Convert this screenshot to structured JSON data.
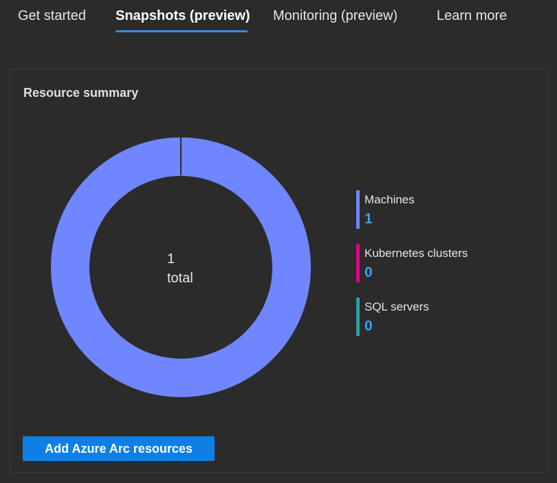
{
  "tabs": [
    {
      "label": "Get started"
    },
    {
      "label": "Snapshots (preview)",
      "active": true
    },
    {
      "label": "Monitoring (preview)"
    },
    {
      "label": "Learn more"
    }
  ],
  "resource_summary": {
    "title": "Resource summary",
    "total_value": "1",
    "total_label": "total",
    "legend": [
      {
        "label": "Machines",
        "value": "1",
        "color": "#6f86ff"
      },
      {
        "label": "Kubernetes clusters",
        "value": "0",
        "color": "#e3008c"
      },
      {
        "label": "SQL servers",
        "value": "0",
        "color": "#2aa0a4"
      }
    ],
    "accent_color": "#2f8cf0",
    "value_color": "#3aa0f2"
  },
  "actions": {
    "add_label": "Add Azure Arc resources"
  }
}
